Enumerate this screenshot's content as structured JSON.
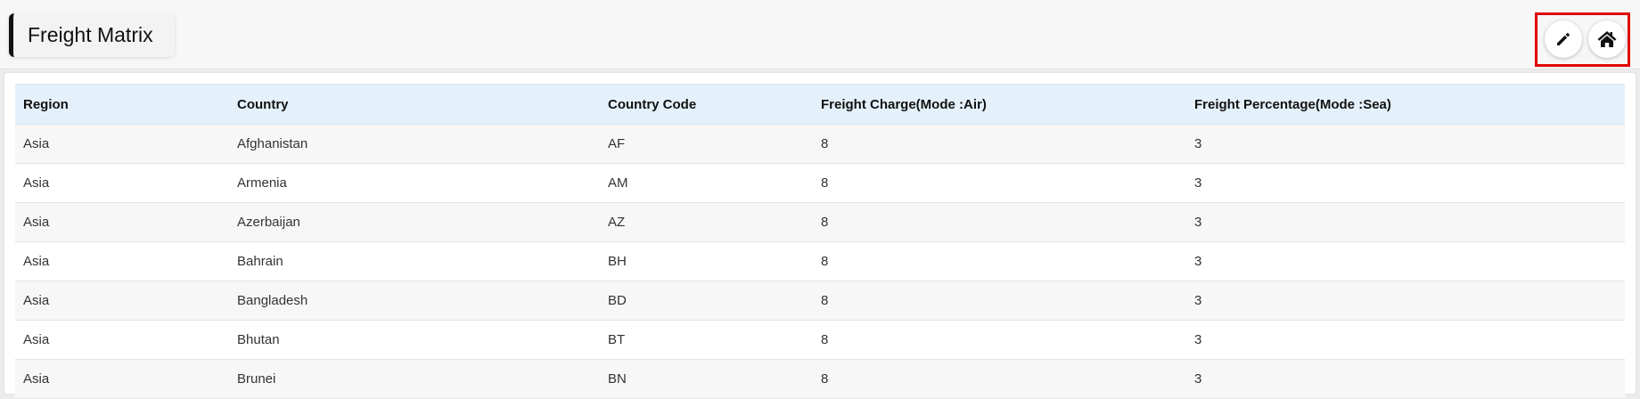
{
  "page": {
    "title": "Freight Matrix"
  },
  "toolbar": {
    "edit_icon": "pencil-icon",
    "home_icon": "home-icon",
    "highlight_color": "#e00000"
  },
  "table": {
    "headers": [
      "Region",
      "Country",
      "Country Code",
      "Freight Charge(Mode :Air)",
      "Freight Percentage(Mode :Sea)"
    ],
    "rows": [
      [
        "Asia",
        "Afghanistan",
        "AF",
        "8",
        "3"
      ],
      [
        "Asia",
        "Armenia",
        "AM",
        "8",
        "3"
      ],
      [
        "Asia",
        "Azerbaijan",
        "AZ",
        "8",
        "3"
      ],
      [
        "Asia",
        "Bahrain",
        "BH",
        "8",
        "3"
      ],
      [
        "Asia",
        "Bangladesh",
        "BD",
        "8",
        "3"
      ],
      [
        "Asia",
        "Bhutan",
        "BT",
        "8",
        "3"
      ],
      [
        "Asia",
        "Brunei",
        "BN",
        "8",
        "3"
      ]
    ]
  }
}
